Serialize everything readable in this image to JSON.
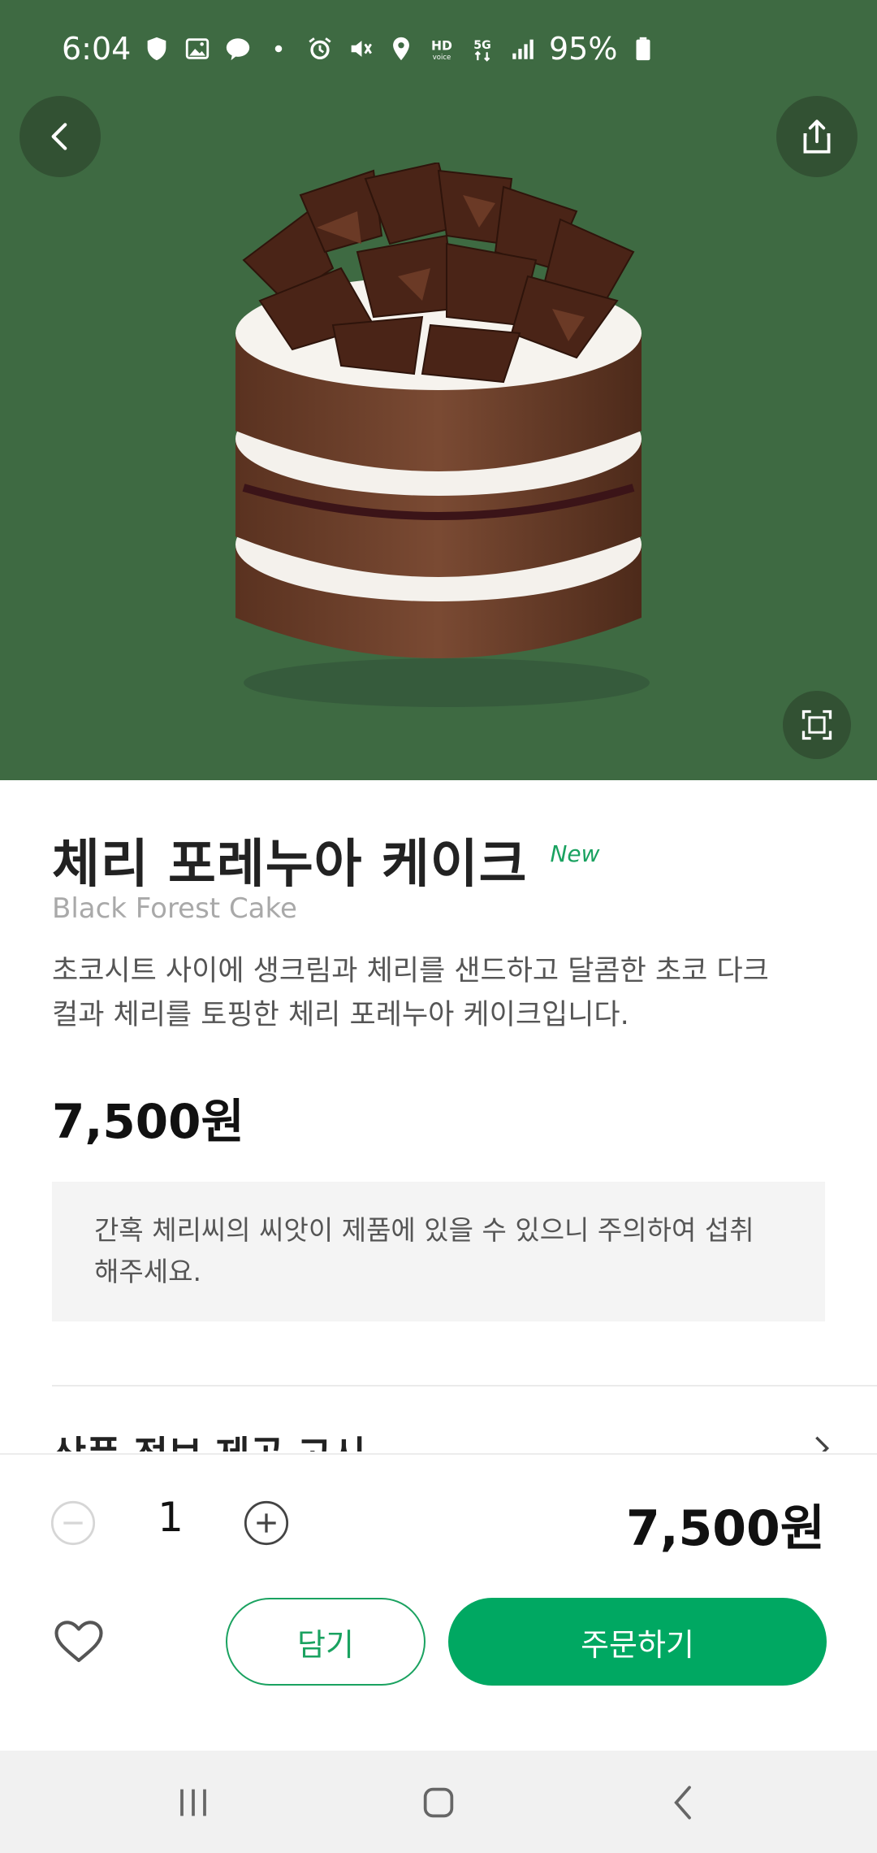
{
  "status_bar": {
    "time": "6:04",
    "battery": "95%",
    "network": "5G",
    "icons_left": [
      "shield-icon",
      "gallery-icon",
      "talk-icon",
      "dot-icon"
    ],
    "icons_right": [
      "alarm-icon",
      "mute-icon",
      "location-icon",
      "hd-voice-icon",
      "5g-icon",
      "signal-icon",
      "battery-icon"
    ]
  },
  "hero": {
    "background_color": "#3e6a42",
    "image": "black-forest-cake-image"
  },
  "product": {
    "name": "체리 포레누아 케이크",
    "badge": "New",
    "english_name": "Black Forest Cake",
    "description": "초코시트 사이에 생크림과 체리를 샌드하고 달콤한 초코 다크컬과 체리를 토핑한 체리 포레누아 케이크입니다.",
    "price": "7,500원",
    "notice": "간혹 체리씨의 씨앗이 제품에 있을 수 있으니 주의하여 섭취해주세요.",
    "info_section_title": "상품 정보 제공 고시"
  },
  "order": {
    "quantity": "1",
    "total_price": "7,500원",
    "cart_label": "담기",
    "order_label": "주문하기"
  },
  "colors": {
    "accent": "#00a862",
    "badge": "#1aa260",
    "hero": "#3e6a42"
  }
}
